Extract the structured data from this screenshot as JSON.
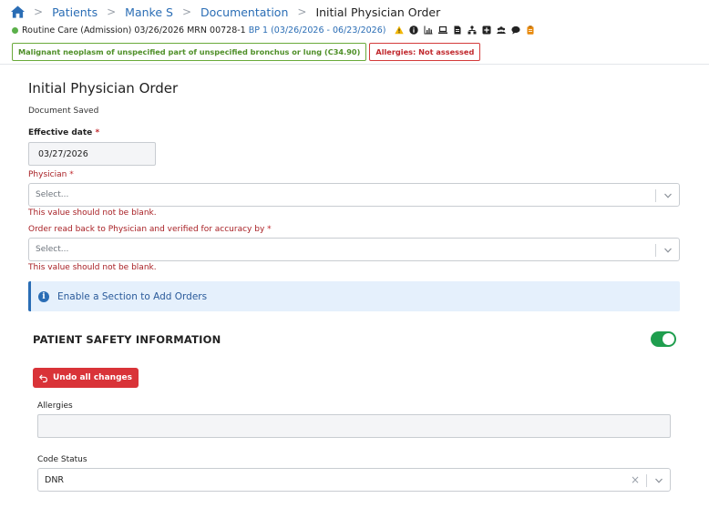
{
  "breadcrumb": {
    "items": [
      {
        "label": "Patients"
      },
      {
        "label": "Manke S"
      },
      {
        "label": "Documentation"
      }
    ],
    "current": "Initial Physician Order"
  },
  "patient": {
    "summary": "Routine Care (Admission) 03/26/2026 MRN 00728-1",
    "benefit_period": "BP 1 (03/26/2026 - 06/23/2026)",
    "status_color": "#5bb04a",
    "icons": [
      "warning-icon",
      "info-icon",
      "chart-icon",
      "laptop-icon",
      "document-icon",
      "org-chart-icon",
      "plus-square-icon",
      "group-icon",
      "chat-icon",
      "clipboard-icon"
    ]
  },
  "tags": {
    "diagnosis": "Malignant neoplasm of unspecified part of unspecified bronchus or lung (C34.90)",
    "allergies": "Allergies: Not assessed"
  },
  "form": {
    "title": "Initial Physician Order",
    "status": "Document Saved",
    "effective_date": {
      "label": "Effective date",
      "value": "03/27/2026"
    },
    "physician": {
      "label": "Physician",
      "placeholder": "Select...",
      "error": "This value should not be blank."
    },
    "read_back": {
      "label": "Order read back to Physician and verified for accuracy by",
      "placeholder": "Select...",
      "error": "This value should not be blank."
    },
    "info_message": "Enable a Section to Add Orders"
  },
  "safety": {
    "title": "PATIENT SAFETY INFORMATION",
    "toggle_on": true,
    "undo_label": "Undo all changes",
    "allergies_label": "Allergies",
    "allergies_value": "",
    "code_status_label": "Code Status",
    "code_status_value": "DNR"
  },
  "colors": {
    "link": "#2a6db5",
    "error": "#a82025",
    "toggle": "#1f9e4e",
    "undo": "#d93338",
    "info_bg": "#e5f0fc"
  }
}
